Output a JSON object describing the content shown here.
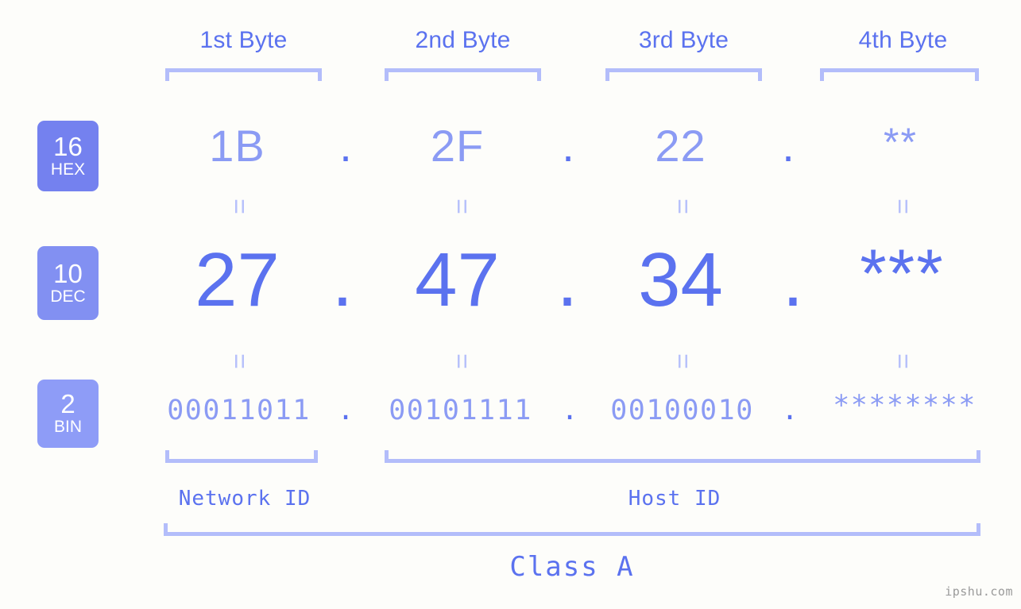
{
  "background_color": "#fdfdfa",
  "accent_color": "#5b72ef",
  "accent_light_color": "#8b9bf4",
  "bracket_color": "#b3bdfa",
  "byte_headers": [
    {
      "label": "1st Byte"
    },
    {
      "label": "2nd Byte"
    },
    {
      "label": "3rd Byte"
    },
    {
      "label": "4th Byte"
    }
  ],
  "radix_badges": [
    {
      "number": "16",
      "name": "HEX",
      "color": "#7481ef"
    },
    {
      "number": "10",
      "name": "DEC",
      "color": "#8290f2"
    },
    {
      "number": "2",
      "name": "BIN",
      "color": "#8e9cf7"
    }
  ],
  "rows": {
    "hex": {
      "radix": "16",
      "radix_name": "HEX",
      "values": [
        "1B",
        "2F",
        "22",
        "**"
      ],
      "separator": "."
    },
    "dec": {
      "radix": "10",
      "radix_name": "DEC",
      "values": [
        "27",
        "47",
        "34",
        "***"
      ],
      "separator": "."
    },
    "bin": {
      "radix": "2",
      "radix_name": "BIN",
      "values": [
        "00011011",
        "00101111",
        "00100010",
        "********"
      ],
      "separator": "."
    }
  },
  "equals_marks": {
    "glyph": "="
  },
  "segments": {
    "network_id": {
      "label": "Network ID"
    },
    "host_id": {
      "label": "Host ID"
    }
  },
  "class": {
    "label": "Class A"
  },
  "watermark": {
    "text": "ipshu.com"
  }
}
